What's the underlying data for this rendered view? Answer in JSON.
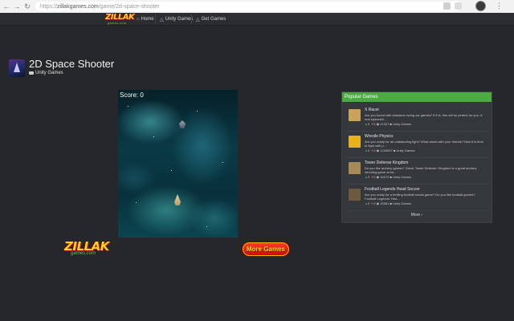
{
  "browser": {
    "url_prefix": "https://",
    "url_host": "zillakgames.com",
    "url_path": "/game/2d-space-shooter"
  },
  "site": {
    "logo_text": "ZILLAK",
    "logo_sub": "games.com",
    "nav": [
      {
        "label": "Home",
        "icon": "home-icon"
      },
      {
        "label": "Unity Games",
        "icon": "trophy-icon"
      },
      {
        "label": "Get Games",
        "icon": "trophy-icon"
      }
    ]
  },
  "game": {
    "title": "2D Space Shooter",
    "category": "Unity Games",
    "score_label": "Score: 0"
  },
  "bottom": {
    "logo_text": "ZILLAK",
    "logo_sub": "games.com",
    "more_games": "More Games"
  },
  "popular": {
    "heading": "Popular Games",
    "items": [
      {
        "title": "X Racer",
        "desc": "Are you bored with standard racing car games? If it is, this will be perfect for you. A real spaceshi...",
        "up": "0",
        "down": "0",
        "views": "21327",
        "category": "Unity Games",
        "thumb_color": "#c9a35b"
      },
      {
        "title": "Wrestle Physics",
        "desc": "Are you ready for an outstanding fight? What about with your friends? Now it is time to fight with p...",
        "up": "0",
        "down": "0",
        "views": "1243007",
        "category": "Unity Games",
        "thumb_color": "#e7b21c"
      },
      {
        "title": "Tower Defense Kingdom",
        "desc": "Do you like archery games? Great. Tower Defense: Kingdom is a great archery shooting game at ea...",
        "up": "0",
        "down": "0",
        "views": "16272",
        "category": "Unity Games",
        "thumb_color": "#a78a55"
      },
      {
        "title": "Football Legends Head Soccer",
        "desc": "Are you ready for a thrilling football heads game? Do you like football games? Football Legends: Hea...",
        "up": "0",
        "down": "0",
        "views": "15981",
        "category": "Unity Games",
        "thumb_color": "#6b5a3e"
      }
    ],
    "more_label": "More"
  },
  "colors": {
    "page_bg": "#25272b",
    "panel_head": "#4caa42",
    "more_games_bg": "#d01a12",
    "more_games_text": "#ffe600"
  }
}
